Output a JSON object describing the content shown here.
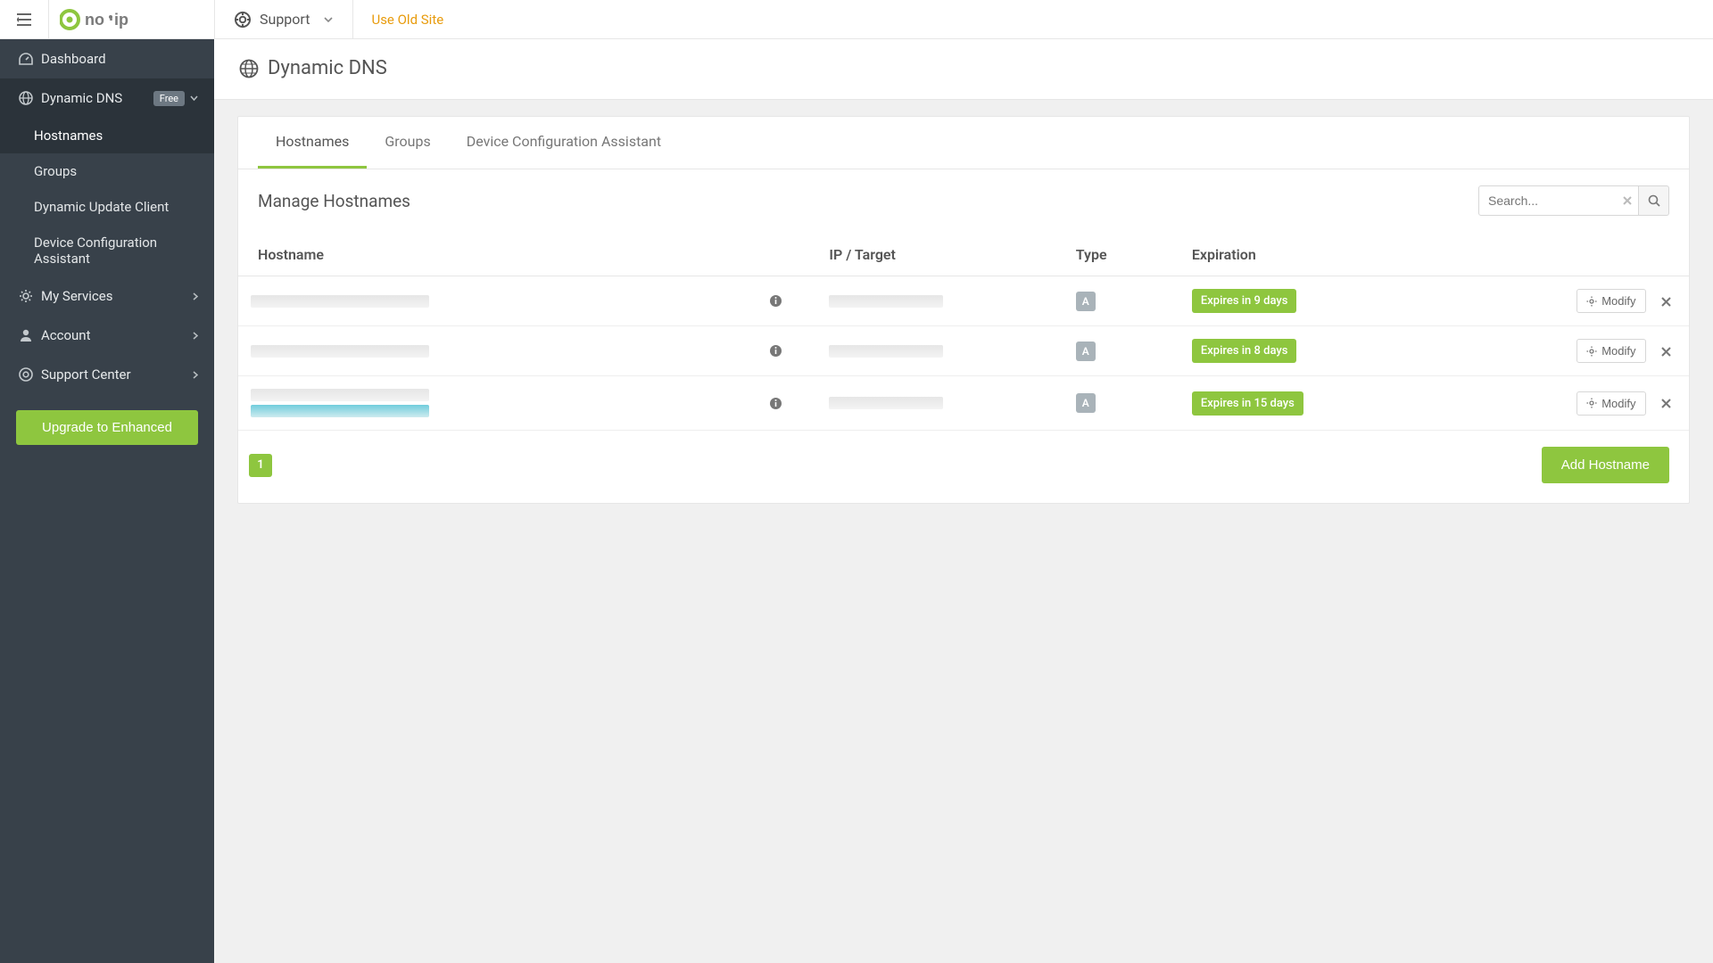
{
  "topbar": {
    "support_label": "Support",
    "old_site_label": "Use Old Site"
  },
  "sidebar": {
    "dashboard": "Dashboard",
    "dynamic_dns": "Dynamic DNS",
    "free_badge": "Free",
    "sub": {
      "hostnames": "Hostnames",
      "groups": "Groups",
      "duc": "Dynamic Update Client",
      "dca": "Device Configuration Assistant"
    },
    "my_services": "My Services",
    "account": "Account",
    "support_center": "Support Center",
    "upgrade": "Upgrade to Enhanced"
  },
  "page": {
    "title": "Dynamic DNS"
  },
  "tabs": {
    "hostnames": "Hostnames",
    "groups": "Groups",
    "dca": "Device Configuration Assistant"
  },
  "panel": {
    "title": "Manage Hostnames",
    "search_placeholder": "Search..."
  },
  "table": {
    "col_hostname": "Hostname",
    "col_ip": "IP / Target",
    "col_type": "Type",
    "col_expiration": "Expiration",
    "rows": [
      {
        "type": "A",
        "expiration": "Expires in 9 days",
        "modify": "Modify"
      },
      {
        "type": "A",
        "expiration": "Expires in 8 days",
        "modify": "Modify"
      },
      {
        "type": "A",
        "expiration": "Expires in 15 days",
        "modify": "Modify"
      }
    ]
  },
  "footer": {
    "page": "1",
    "add_hostname": "Add Hostname"
  }
}
